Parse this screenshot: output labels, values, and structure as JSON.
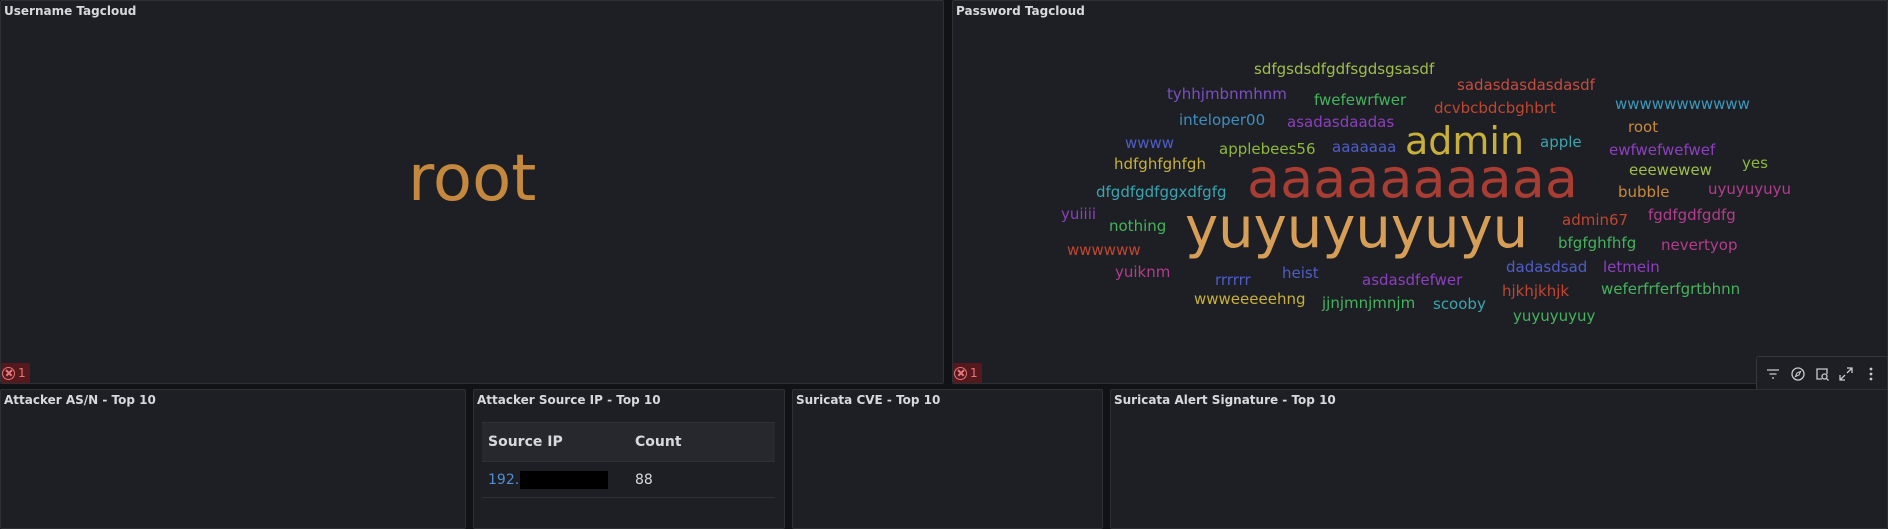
{
  "panels": {
    "username": {
      "title": "Username Tagcloud",
      "word": "root",
      "word_color": "#c4893e",
      "error_count": "1"
    },
    "password": {
      "title": "Password Tagcloud",
      "error_count": "1",
      "words": [
        {
          "text": "sdfgsdsdfgdfsgdsgsasdf",
          "color": "#9fbe4a"
        },
        {
          "text": "tyhhjmbnmhnm",
          "color": "#7a4fc0"
        },
        {
          "text": "fwefewrfwer",
          "color": "#44b35c"
        },
        {
          "text": "sadasdasdasdasdf",
          "color": "#c64c3f"
        },
        {
          "text": "dcvbcbdcbghbrt",
          "color": "#c1452f"
        },
        {
          "text": "wwwwwwwwwww",
          "color": "#3a98bb"
        },
        {
          "text": "inteloper00",
          "color": "#3d8fbf"
        },
        {
          "text": "asadasdaadas",
          "color": "#8c3fbf"
        },
        {
          "text": "root",
          "color": "#c98a3c"
        },
        {
          "text": "wwww",
          "color": "#4e5dc8"
        },
        {
          "text": "applebees56",
          "color": "#8db83a"
        },
        {
          "text": "aaaaaaa",
          "color": "#4e5dc8"
        },
        {
          "text": "admin",
          "color": "#c8b13a"
        },
        {
          "text": "apple",
          "color": "#3aa5b0"
        },
        {
          "text": "ewfwefwefwef",
          "color": "#8c3fbf"
        },
        {
          "text": "hdfghfghfgh",
          "color": "#c8b13a"
        },
        {
          "text": "eeewewew",
          "color": "#9fbe4a"
        },
        {
          "text": "yes",
          "color": "#8db83a"
        },
        {
          "text": "dfgdfgdfggxdfgfg",
          "color": "#3aa5b0"
        },
        {
          "text": "aaaaaaaaaa",
          "color": "#a83d33"
        },
        {
          "text": "bubble",
          "color": "#c98a3c"
        },
        {
          "text": "uyuyuyuyu",
          "color": "#b33d8c"
        },
        {
          "text": "yuiiii",
          "color": "#8c3fbf"
        },
        {
          "text": "yuyuyuyuyu",
          "color": "#d79e57"
        },
        {
          "text": "admin67",
          "color": "#c1452f"
        },
        {
          "text": "fgdfgdfgdfg",
          "color": "#b33d8c"
        },
        {
          "text": "nothing",
          "color": "#44b35c"
        },
        {
          "text": "bfgfghfhfg",
          "color": "#44b35c"
        },
        {
          "text": "wwwwww",
          "color": "#c1452f"
        },
        {
          "text": "nevertyop",
          "color": "#b33d8c"
        },
        {
          "text": "heist",
          "color": "#4e5dc8"
        },
        {
          "text": "dadasdsad",
          "color": "#4e5dc8"
        },
        {
          "text": "letmein",
          "color": "#8c3fbf"
        },
        {
          "text": "yuiknm",
          "color": "#b33d8c"
        },
        {
          "text": "rrrrrr",
          "color": "#4e5dc8"
        },
        {
          "text": "asdasdfefwer",
          "color": "#8c3fbf"
        },
        {
          "text": "hjkhjkhjk",
          "color": "#c1452f"
        },
        {
          "text": "weferfrferfgrtbhnn",
          "color": "#44b35c"
        },
        {
          "text": "wwweeeeehng",
          "color": "#c8b13a"
        },
        {
          "text": "jjnjmnjmnjm",
          "color": "#44b35c"
        },
        {
          "text": "scooby",
          "color": "#3aa5b0"
        },
        {
          "text": "yuyuyuyuy",
          "color": "#44b35c"
        }
      ]
    },
    "asn": {
      "title": "Attacker AS/N - Top 10"
    },
    "source_ip": {
      "title": "Attacker Source IP - Top 10",
      "columns": [
        "Source IP",
        "Count"
      ],
      "rows": [
        {
          "ip": "192.",
          "count": "88"
        }
      ]
    },
    "cve": {
      "title": "Suricata CVE - Top 10"
    },
    "signature": {
      "title": "Suricata Alert Signature - Top 10"
    }
  },
  "toolbar": {
    "icons": [
      "filter-icon",
      "explore-icon",
      "inspect-icon",
      "expand-icon",
      "more-icon"
    ]
  },
  "colors": {
    "background": "#111215",
    "panel": "#1e1f24",
    "error_badge": "#55181c",
    "link": "#4f8fd4"
  }
}
